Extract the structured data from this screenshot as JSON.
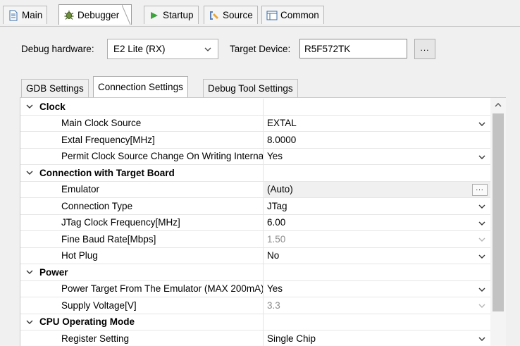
{
  "top_tabs": [
    {
      "label": "Main",
      "icon": "page-icon"
    },
    {
      "label": "Debugger",
      "icon": "bug-icon"
    },
    {
      "label": "Startup",
      "icon": "play-icon"
    },
    {
      "label": "Source",
      "icon": "source-icon"
    },
    {
      "label": "Common",
      "icon": "common-icon"
    }
  ],
  "debug_hardware": {
    "label": "Debug hardware:",
    "value": "E2 Lite (RX)"
  },
  "target_device": {
    "label": "Target Device:",
    "value": "R5F572TK",
    "browse_label": "..."
  },
  "sub_tabs": [
    "GDB Settings",
    "Connection Settings",
    "Debug Tool Settings"
  ],
  "grid": {
    "categories": [
      {
        "title": "Clock",
        "items": [
          {
            "name": "Main Clock Source",
            "value": "EXTAL"
          },
          {
            "name": "Extal Frequency[MHz]",
            "value": "8.0000"
          },
          {
            "name": "Permit Clock Source Change On Writing Internal Flash Memory",
            "value": "Yes"
          }
        ]
      },
      {
        "title": "Connection with Target Board",
        "items": [
          {
            "name": "Emulator",
            "value": "(Auto)",
            "button": "..."
          },
          {
            "name": "Connection Type",
            "value": "JTag"
          },
          {
            "name": "JTag Clock Frequency[MHz]",
            "value": "6.00"
          },
          {
            "name": "Fine Baud Rate[Mbps]",
            "value": "1.50"
          },
          {
            "name": "Hot Plug",
            "value": "No"
          }
        ]
      },
      {
        "title": "Power",
        "items": [
          {
            "name": "Power Target From The Emulator (MAX 200mA)",
            "value": "Yes"
          },
          {
            "name": "Supply Voltage[V]",
            "value": "3.3"
          }
        ]
      },
      {
        "title": "CPU Operating Mode",
        "items": [
          {
            "name": "Register Setting",
            "value": "Single Chip"
          }
        ]
      }
    ]
  }
}
